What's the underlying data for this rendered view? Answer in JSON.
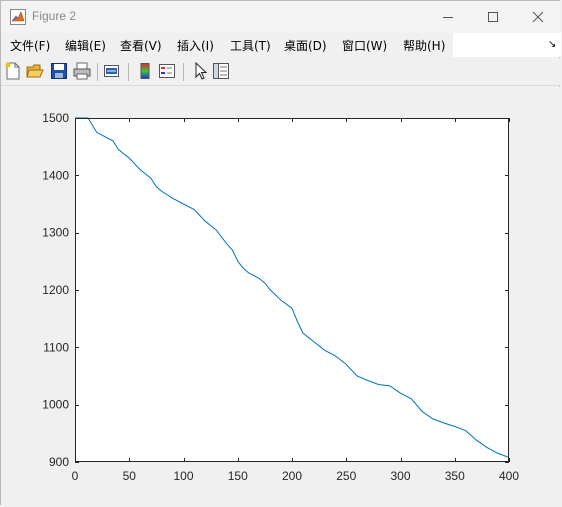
{
  "window": {
    "title": "Figure 2"
  },
  "menu": {
    "items": [
      "文件(F)",
      "编辑(E)",
      "查看(V)",
      "插入(I)",
      "工具(T)",
      "桌面(D)",
      "窗口(W)",
      "帮助(H)"
    ],
    "overflow_arrow": "↘"
  },
  "toolbar": {
    "icons": [
      "new-figure-icon",
      "open-file-icon",
      "save-icon",
      "print-icon",
      "link-figure-icon",
      "colorbar-icon",
      "legend-icon",
      "pointer-icon",
      "property-inspector-icon"
    ]
  },
  "colors": {
    "line": "#0072bd",
    "axis": "#262626",
    "background": "#f0f0f0"
  },
  "chart_data": {
    "type": "line",
    "title": "",
    "xlabel": "",
    "ylabel": "",
    "xlim": [
      0,
      400
    ],
    "ylim": [
      900,
      1500
    ],
    "xticks": [
      0,
      50,
      100,
      150,
      200,
      250,
      300,
      350,
      400
    ],
    "yticks": [
      900,
      1000,
      1100,
      1200,
      1300,
      1400,
      1500
    ],
    "grid": false,
    "series": [
      {
        "x": [
          0,
          12,
          20,
          25,
          35,
          40,
          50,
          60,
          70,
          75,
          80,
          90,
          100,
          110,
          120,
          130,
          140,
          145,
          150,
          155,
          160,
          165,
          170,
          175,
          180,
          190,
          200,
          205,
          210,
          220,
          230,
          240,
          250,
          260,
          270,
          280,
          290,
          300,
          310,
          320,
          330,
          340,
          350,
          360,
          370,
          380,
          390,
          400
        ],
        "y": [
          1500,
          1500,
          1475,
          1470,
          1460,
          1445,
          1430,
          1410,
          1395,
          1380,
          1372,
          1360,
          1350,
          1340,
          1320,
          1305,
          1280,
          1270,
          1250,
          1238,
          1230,
          1225,
          1220,
          1212,
          1200,
          1182,
          1168,
          1145,
          1125,
          1110,
          1095,
          1085,
          1070,
          1050,
          1042,
          1035,
          1033,
          1020,
          1010,
          988,
          975,
          968,
          962,
          955,
          938,
          925,
          915,
          908
        ]
      }
    ]
  }
}
